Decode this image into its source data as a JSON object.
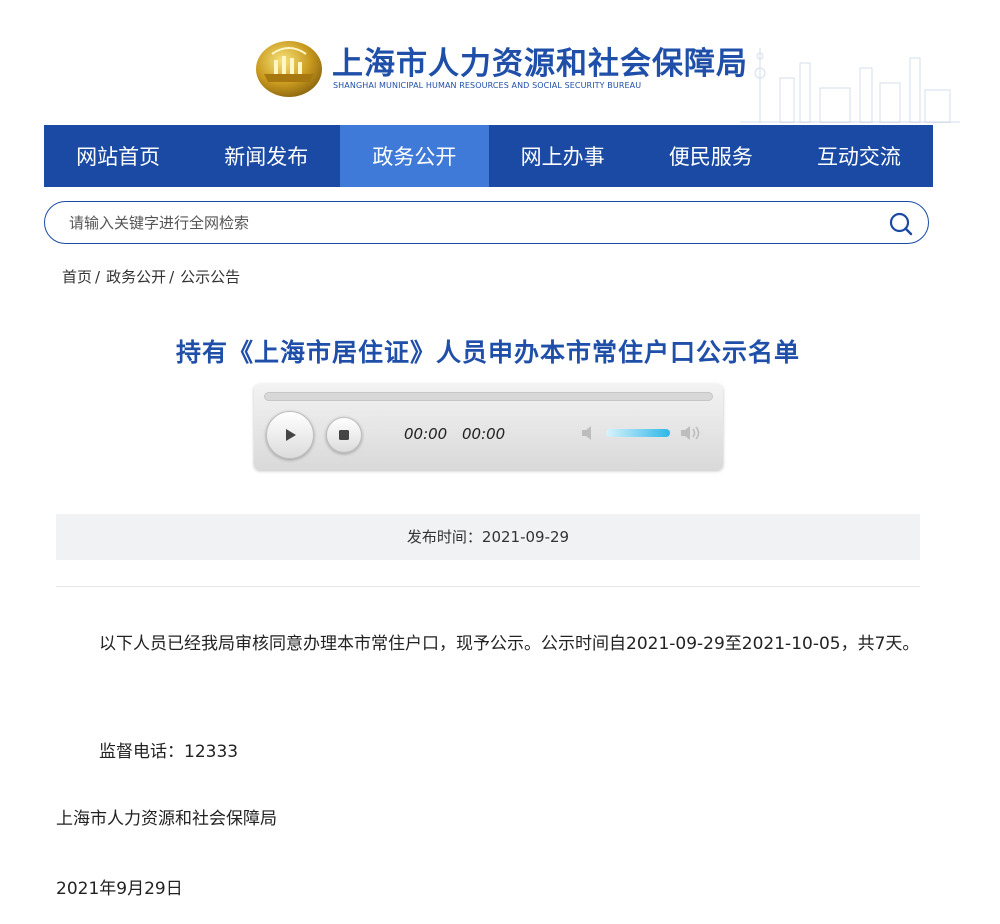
{
  "header": {
    "title": "上海市人力资源和社会保障局",
    "subtitle": "SHANGHAI MUNICIPAL HUMAN RESOURCES AND SOCIAL SECURITY BUREAU",
    "brand_color": "#1f4fa8"
  },
  "nav": {
    "items": [
      {
        "label": "网站首页"
      },
      {
        "label": "新闻发布"
      },
      {
        "label": "政务公开",
        "active": true
      },
      {
        "label": "网上办事"
      },
      {
        "label": "便民服务"
      },
      {
        "label": "互动交流"
      }
    ],
    "bg_color": "#1a4aa3",
    "active_color": "#3f7ad8"
  },
  "search": {
    "placeholder": "请输入关键字进行全网检索",
    "icon": "search-icon"
  },
  "breadcrumb": {
    "items": [
      "首页",
      "政务公开",
      "公示公告"
    ],
    "separator": "/"
  },
  "article": {
    "title": "持有《上海市居住证》人员申办本市常住户口公示名单",
    "publish_label": "发布时间：",
    "publish_date": "2021-09-29",
    "paragraph1": "以下人员已经我局审核同意办理本市常住户口，现予公示。公示时间自2021-09-29至2021-10-05，共7天。",
    "hotline": "监督电话：12333",
    "signature": "上海市人力资源和社会保障局",
    "date": "2021年9月29日"
  },
  "player": {
    "current_time": "00:00",
    "duration": "00:00",
    "progress": 0,
    "icons": [
      "play-icon",
      "stop-icon",
      "volume-mute-icon",
      "volume-max-icon"
    ]
  }
}
